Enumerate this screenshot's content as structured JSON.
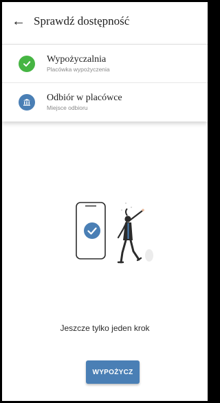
{
  "header": {
    "back_icon": "arrow-left-icon",
    "title": "Sprawdź dostępność"
  },
  "steps": [
    {
      "title": "Wypożyczalnia",
      "subtitle": "Placówka wypożyczenia",
      "status": "done",
      "icon": "check-icon",
      "color": "#46b543"
    },
    {
      "title": "Odbiór w placówce",
      "subtitle": "Miejsce odbioru",
      "status": "pending",
      "icon": "bank-icon",
      "color": "#4a7fb5"
    }
  ],
  "illustration": {
    "icon": "phone-check-person-illustration"
  },
  "main": {
    "message": "Jeszcze tylko jeden krok",
    "button_label": "WYPOŻYCZ",
    "accent_color": "#4a7fb5"
  }
}
